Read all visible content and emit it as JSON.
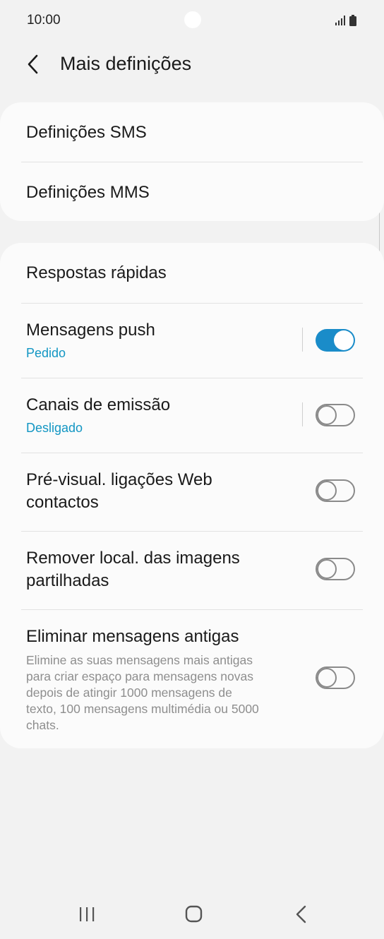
{
  "status_bar": {
    "time": "10:00"
  },
  "header": {
    "title": "Mais definições"
  },
  "card1": {
    "items": [
      {
        "label": "Definições SMS"
      },
      {
        "label": "Definições MMS"
      }
    ]
  },
  "card2": {
    "quick_responses": {
      "label": "Respostas rápidas"
    },
    "push": {
      "label": "Mensagens push",
      "sub": "Pedido",
      "toggle": "on"
    },
    "broadcast": {
      "label": "Canais de emissão",
      "sub": "Desligado",
      "toggle": "off"
    },
    "web_preview": {
      "label_line1": "Pré-visual. ligações Web",
      "label_line2": "contactos",
      "toggle": "off"
    },
    "remove_location": {
      "label_line1": "Remover local. das imagens",
      "label_line2": "partilhadas",
      "toggle": "off"
    },
    "delete_old": {
      "label": "Eliminar mensagens antigas",
      "desc_lines": [
        "Elimine as suas mensagens mais antigas",
        "para criar espaço para mensagens novas",
        "depois de atingir 1000 mensagens de",
        "texto, 100 mensagens multimédia ou 5000",
        "chats."
      ],
      "toggle": "off"
    }
  },
  "colors": {
    "accent": "#1a8cc9",
    "subtext_blue": "#1296c3",
    "background": "#f2f2f2",
    "card": "#fbfbfb"
  },
  "icons": {
    "back": "chevron-left-icon",
    "recent": "recent-apps-icon",
    "home": "home-icon",
    "nav_back": "nav-back-icon"
  }
}
